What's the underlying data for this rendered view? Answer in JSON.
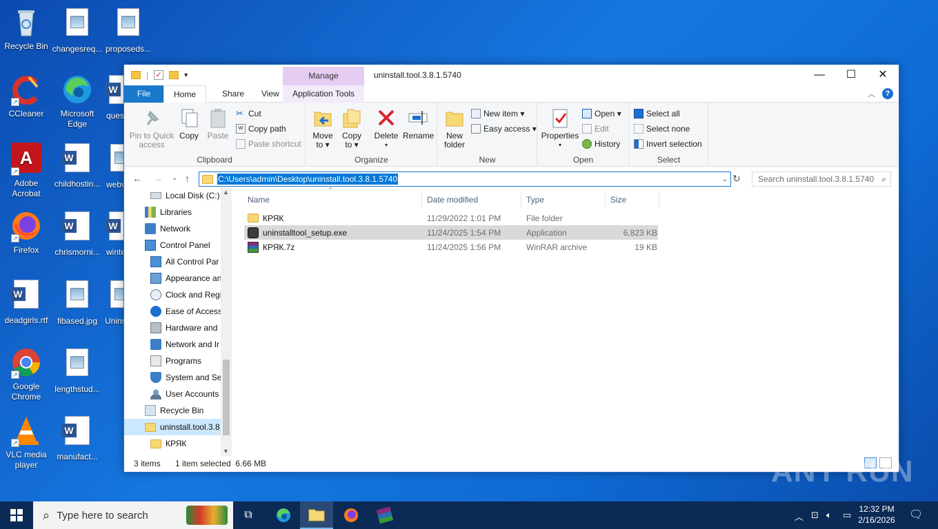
{
  "desktop": {
    "icons": [
      {
        "label": "Recycle Bin"
      },
      {
        "label": "changesreq..."
      },
      {
        "label": "proposeds..."
      },
      {
        "label": "CCleaner"
      },
      {
        "label": "Microsoft Edge"
      },
      {
        "label": "ques"
      },
      {
        "label": "Adobe Acrobat"
      },
      {
        "label": "childhostin..."
      },
      {
        "label": "webv"
      },
      {
        "label": "Firefox"
      },
      {
        "label": "chrismorni..."
      },
      {
        "label": "winte"
      },
      {
        "label": "deadgirls.rtf"
      },
      {
        "label": "fibased.jpg"
      },
      {
        "label": "Unins"
      },
      {
        "label": "Google Chrome"
      },
      {
        "label": "lengthstud..."
      },
      {
        "label": "VLC media player"
      },
      {
        "label": "manufact..."
      }
    ]
  },
  "window": {
    "title": "uninstall.tool.3.8.1.5740",
    "manage_label": "Manage",
    "tabs": {
      "file": "File",
      "home": "Home",
      "share": "Share",
      "view": "View",
      "app_tools": "Application Tools"
    },
    "controls": {
      "minimize": "—",
      "maximize": "☐",
      "close": "✕"
    }
  },
  "ribbon": {
    "clipboard": {
      "label": "Clipboard",
      "pin": "Pin to Quick access",
      "copy": "Copy",
      "paste": "Paste",
      "cut": "Cut",
      "copy_path": "Copy path",
      "paste_shortcut": "Paste shortcut"
    },
    "organize": {
      "label": "Organize",
      "move_to": "Move to ▾",
      "copy_to": "Copy to ▾",
      "delete": "Delete",
      "rename": "Rename"
    },
    "new": {
      "label": "New",
      "new_folder": "New folder",
      "new_item": "New item ▾",
      "easy_access": "Easy access ▾"
    },
    "open": {
      "label": "Open",
      "properties": "Properties",
      "open": "Open ▾",
      "edit": "Edit",
      "history": "History"
    },
    "select": {
      "label": "Select",
      "select_all": "Select all",
      "select_none": "Select none",
      "invert": "Invert selection"
    }
  },
  "address": {
    "path": "C:\\Users\\admin\\Desktop\\uninstall.tool.3.8.1.5740",
    "search_placeholder": "Search uninstall.tool.3.8.1.5740"
  },
  "nav": {
    "items": [
      {
        "label": "Local Disk (C:)",
        "icon": "drive-icon"
      },
      {
        "label": "Libraries",
        "icon": "libraries-icon"
      },
      {
        "label": "Network",
        "icon": "network-icon"
      },
      {
        "label": "Control Panel",
        "icon": "control-panel-icon"
      },
      {
        "label": "All Control Par",
        "icon": "control-panel-icon"
      },
      {
        "label": "Appearance an",
        "icon": "appearance-icon"
      },
      {
        "label": "Clock and Regi",
        "icon": "clock-icon"
      },
      {
        "label": "Ease of Access",
        "icon": "ease-of-access-icon"
      },
      {
        "label": "Hardware and",
        "icon": "hardware-icon"
      },
      {
        "label": "Network and Ir",
        "icon": "network-icon"
      },
      {
        "label": "Programs",
        "icon": "programs-icon"
      },
      {
        "label": "System and Se",
        "icon": "shield-icon"
      },
      {
        "label": "User Accounts",
        "icon": "users-icon"
      },
      {
        "label": "Recycle Bin",
        "icon": "recycle-bin-icon"
      },
      {
        "label": "uninstall.tool.3.8",
        "icon": "folder-icon"
      },
      {
        "label": "КРЯК",
        "icon": "folder-icon"
      }
    ]
  },
  "files": {
    "columns": {
      "name": "Name",
      "date": "Date modified",
      "type": "Type",
      "size": "Size"
    },
    "rows": [
      {
        "name": "КРЯК",
        "date": "11/29/2022 1:01 PM",
        "type": "File folder",
        "size": ""
      },
      {
        "name": "uninstalltool_setup.exe",
        "date": "11/24/2025 1:54 PM",
        "type": "Application",
        "size": "6,823 KB"
      },
      {
        "name": "КРЯК.7z",
        "date": "11/24/2025 1:56 PM",
        "type": "WinRAR archive",
        "size": "19 KB"
      }
    ]
  },
  "status": {
    "count": "3 items",
    "selected": "1 item selected  6.66 MB"
  },
  "taskbar": {
    "search_placeholder": "Type here to search",
    "time": "12:32 PM",
    "date": "2/16/2026"
  },
  "watermark": "ANY RUN",
  "colors": {
    "accent": "#1979ca",
    "manage": "#e5cdf2",
    "selection": "#cce8ff"
  }
}
